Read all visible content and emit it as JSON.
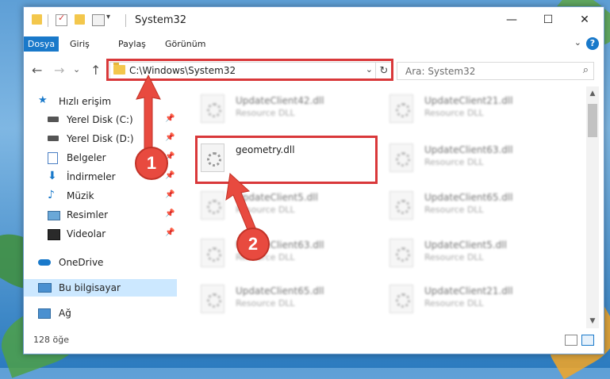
{
  "window": {
    "title": "System32",
    "controls": {
      "minimize": "—",
      "maximize": "☐",
      "close": "✕"
    }
  },
  "ribbon": {
    "tabs": [
      "Dosya",
      "Giriş",
      "Paylaş",
      "Görünüm"
    ],
    "expand_chevron": "⌄",
    "help": "?"
  },
  "navigation": {
    "back": "←",
    "forward": "→",
    "recent": "⌄",
    "up": "↑",
    "address": "C:\\Windows\\System32",
    "address_dropdown": "⌄",
    "refresh": "↻",
    "search_placeholder": "Ara: System32"
  },
  "sidebar": {
    "items": [
      {
        "label": "Hızlı erişim",
        "icon": "star-icon",
        "pinned": false
      },
      {
        "label": "Yerel Disk (C:)",
        "icon": "drive-icon",
        "pinned": true
      },
      {
        "label": "Yerel Disk (D:)",
        "icon": "drive-icon",
        "pinned": true
      },
      {
        "label": "Belgeler",
        "icon": "documents-icon",
        "pinned": true
      },
      {
        "label": "İndirmeler",
        "icon": "download-icon",
        "pinned": true
      },
      {
        "label": "Müzik",
        "icon": "music-icon",
        "pinned": true
      },
      {
        "label": "Resimler",
        "icon": "pictures-icon",
        "pinned": true
      },
      {
        "label": "Videolar",
        "icon": "videos-icon",
        "pinned": true
      },
      {
        "label": "OneDrive",
        "icon": "cloud-icon",
        "pinned": false
      },
      {
        "label": "Bu bilgisayar",
        "icon": "computer-icon",
        "pinned": false,
        "selected": true
      },
      {
        "label": "Ağ",
        "icon": "network-icon",
        "pinned": false
      }
    ],
    "pin_glyph": "📌"
  },
  "files": {
    "left_column": [
      {
        "name": "UpdateClient42.dll",
        "type": "Resource DLL",
        "blurred": true
      },
      {
        "name": "geometry.dll",
        "type": "",
        "blurred": false,
        "highlighted": true
      },
      {
        "name": "UpdateClient5.dll",
        "type": "Resource DLL",
        "blurred": true
      },
      {
        "name": "UpdateClient63.dll",
        "type": "Resource DLL",
        "blurred": true
      },
      {
        "name": "UpdateClient65.dll",
        "type": "Resource DLL",
        "blurred": true
      }
    ],
    "right_column": [
      {
        "name": "UpdateClient21.dll",
        "type": "Resource DLL",
        "blurred": true
      },
      {
        "name": "UpdateClient63.dll",
        "type": "Resource DLL",
        "blurred": true
      },
      {
        "name": "UpdateClient65.dll",
        "type": "Resource DLL",
        "blurred": true
      },
      {
        "name": "UpdateClient5.dll",
        "type": "Resource DLL",
        "blurred": true
      },
      {
        "name": "UpdateClient21.dll",
        "type": "Resource DLL",
        "blurred": true
      }
    ]
  },
  "status": {
    "item_count": "128 öğe"
  },
  "annotations": {
    "step1": "1",
    "step2": "2",
    "color": "#e84a3f"
  }
}
